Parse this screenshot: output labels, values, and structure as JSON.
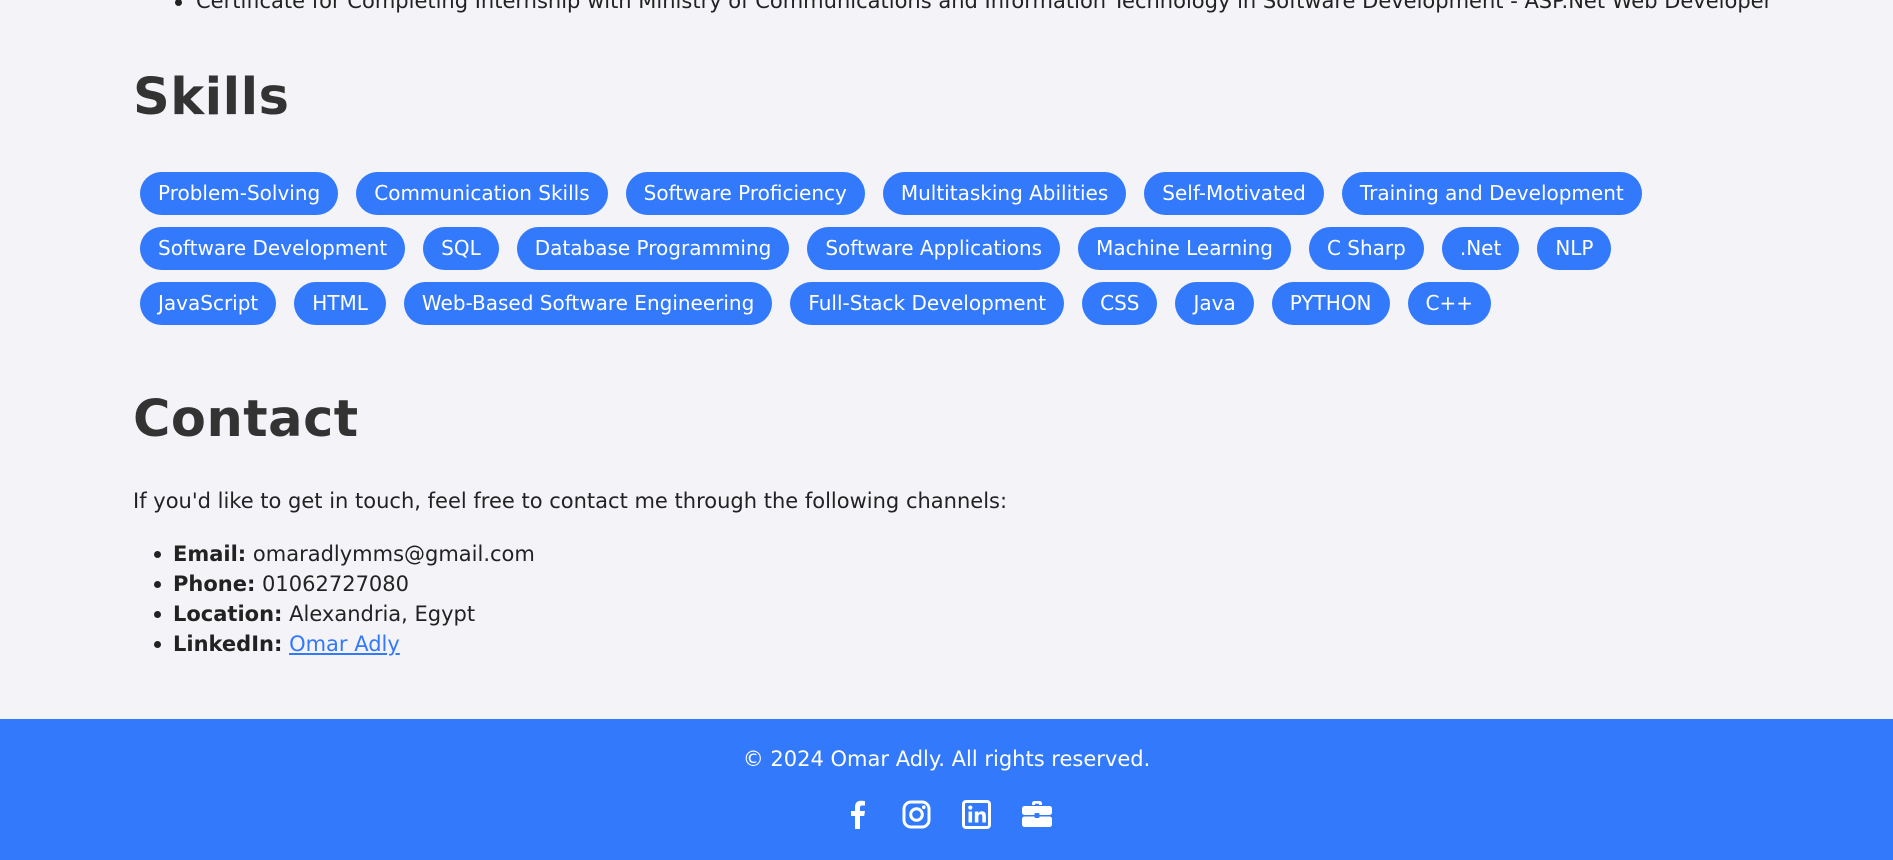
{
  "previous_section": {
    "last_item": "Certificate for Completing Internship with Ministry of Communications and Information Technology in Software Development - ASP.Net Web Developer"
  },
  "skills": {
    "title": "Skills",
    "items": [
      "Problem-Solving",
      "Communication Skills",
      "Software Proficiency",
      "Multitasking Abilities",
      "Self-Motivated",
      "Training and Development",
      "Software Development",
      "SQL",
      "Database Programming",
      "Software Applications",
      "Machine Learning",
      "C Sharp",
      ".Net",
      "NLP",
      "JavaScript",
      "HTML",
      "Web-Based Software Engineering",
      "Full-Stack Development",
      "CSS",
      "Java",
      "PYTHON",
      "C++"
    ]
  },
  "contact": {
    "title": "Contact",
    "intro": "If you'd like to get in touch, feel free to contact me through the following channels:",
    "email_label": "Email:",
    "email_value": "omaradlymms@gmail.com",
    "phone_label": "Phone:",
    "phone_value": "01062727080",
    "location_label": "Location:",
    "location_value": "Alexandria, Egypt",
    "linkedin_label": "LinkedIn:",
    "linkedin_value": "Omar Adly"
  },
  "footer": {
    "copyright": "© 2024 Omar Adly. All rights reserved.",
    "social_icons": [
      "facebook-icon",
      "instagram-icon",
      "linkedin-icon",
      "briefcase-icon"
    ]
  },
  "colors": {
    "accent": "#3279fb",
    "background": "#f4f3f8",
    "heading": "#333333",
    "text": "#222222"
  }
}
